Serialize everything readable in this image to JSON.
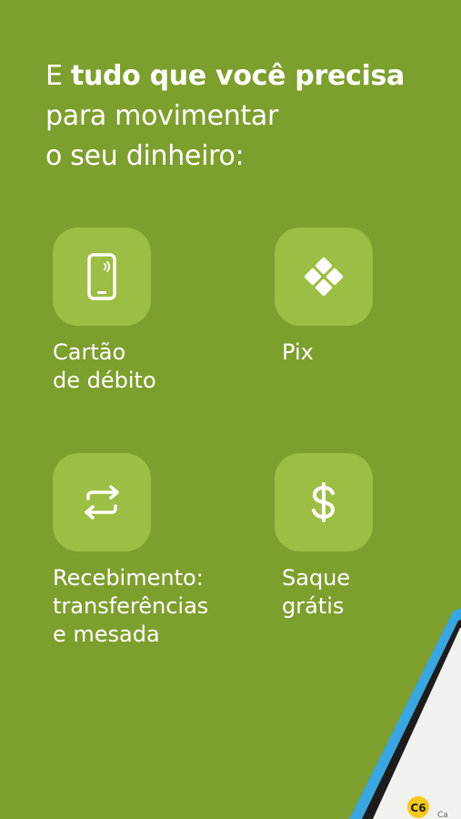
{
  "headline": {
    "line1_regular": "E ",
    "line1_bold": "tudo que você precisa",
    "line2": "para movimentar",
    "line3": "o seu dinheiro:"
  },
  "features": [
    {
      "icon": "phone-contactless-icon",
      "label_line1": "Cartão",
      "label_line2": "de débito"
    },
    {
      "icon": "pix-icon",
      "label_line1": "Pix"
    },
    {
      "icon": "transfer-arrows-icon",
      "label_line1": "Recebimento:",
      "label_line2": "transferências",
      "label_line3": "e mesada"
    },
    {
      "icon": "dollar-sign-icon",
      "label_line1": "Saque",
      "label_line2": "grátis"
    }
  ],
  "phone_preview": {
    "badge": "C6",
    "partial_text": "Ca"
  },
  "colors": {
    "background": "#7d9f2e",
    "tile": "#9cbe44",
    "phone_frame": "#3aa6df"
  }
}
